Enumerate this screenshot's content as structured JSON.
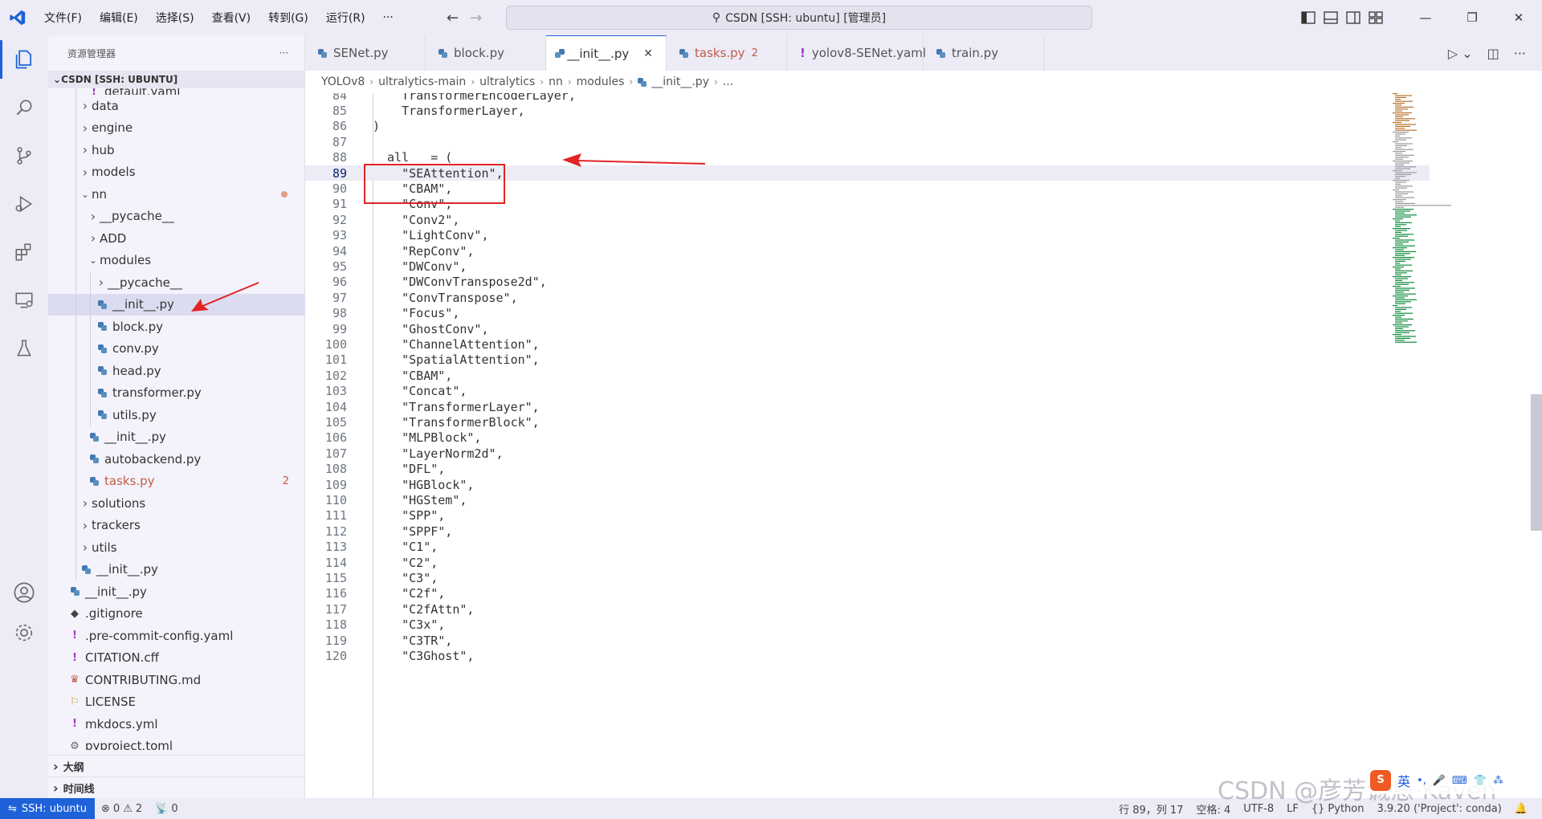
{
  "titlebar": {
    "menu": [
      "文件(F)",
      "编辑(E)",
      "选择(S)",
      "查看(V)",
      "转到(G)",
      "运行(R)",
      "···"
    ],
    "command_center": "CSDN [SSH: ubuntu] [管理员]",
    "accent": "#1e61d9"
  },
  "sidebar": {
    "title": "资源管理器",
    "more": "···",
    "section": "CSDN [SSH: UBUNTU]",
    "tree": [
      {
        "label": "default.yaml",
        "level": 2,
        "type": "yaml-partial"
      },
      {
        "label": "data",
        "level": 1,
        "type": "folder-closed"
      },
      {
        "label": "engine",
        "level": 1,
        "type": "folder-closed"
      },
      {
        "label": "hub",
        "level": 1,
        "type": "folder-closed"
      },
      {
        "label": "models",
        "level": 1,
        "type": "folder-closed"
      },
      {
        "label": "nn",
        "level": 1,
        "type": "folder-open",
        "status": "modified"
      },
      {
        "label": "__pycache__",
        "level": 2,
        "type": "folder-closed"
      },
      {
        "label": "ADD",
        "level": 2,
        "type": "folder-closed"
      },
      {
        "label": "modules",
        "level": 2,
        "type": "folder-open"
      },
      {
        "label": "__pycache__",
        "level": 3,
        "type": "folder-closed"
      },
      {
        "label": "__init__.py",
        "level": 3,
        "type": "py",
        "selected": true
      },
      {
        "label": "block.py",
        "level": 3,
        "type": "py"
      },
      {
        "label": "conv.py",
        "level": 3,
        "type": "py"
      },
      {
        "label": "head.py",
        "level": 3,
        "type": "py"
      },
      {
        "label": "transformer.py",
        "level": 3,
        "type": "py"
      },
      {
        "label": "utils.py",
        "level": 3,
        "type": "py"
      },
      {
        "label": "__init__.py",
        "level": 2,
        "type": "py"
      },
      {
        "label": "autobackend.py",
        "level": 2,
        "type": "py"
      },
      {
        "label": "tasks.py",
        "level": 2,
        "type": "py",
        "status": "error",
        "badge": "2"
      },
      {
        "label": "solutions",
        "level": 1,
        "type": "folder-closed"
      },
      {
        "label": "trackers",
        "level": 1,
        "type": "folder-closed"
      },
      {
        "label": "utils",
        "level": 1,
        "type": "folder-closed"
      },
      {
        "label": "__init__.py",
        "level": 1,
        "type": "py"
      },
      {
        "label": "__init__.py",
        "level": 0,
        "type": "py"
      },
      {
        "label": ".gitignore",
        "level": 0,
        "type": "git"
      },
      {
        "label": ".pre-commit-config.yaml",
        "level": 0,
        "type": "yaml"
      },
      {
        "label": "CITATION.cff",
        "level": 0,
        "type": "yaml"
      },
      {
        "label": "CONTRIBUTING.md",
        "level": 0,
        "type": "md"
      },
      {
        "label": "LICENSE",
        "level": 0,
        "type": "license"
      },
      {
        "label": "mkdocs.yml",
        "level": 0,
        "type": "yaml"
      },
      {
        "label": "pyproject.toml",
        "level": 0,
        "type": "toml-partial"
      }
    ],
    "bottom": [
      "大纲",
      "时间线"
    ]
  },
  "tabs": [
    {
      "label": "SENet.py",
      "type": "py"
    },
    {
      "label": "block.py",
      "type": "py"
    },
    {
      "label": "__init__.py",
      "type": "py",
      "active": true
    },
    {
      "label": "tasks.py",
      "type": "py",
      "error": true,
      "count": "2"
    },
    {
      "label": "yolov8-SENet.yaml",
      "type": "yaml"
    },
    {
      "label": "train.py",
      "type": "py"
    }
  ],
  "breadcrumb": [
    "YOLOv8",
    "ultralytics-main",
    "ultralytics",
    "nn",
    "modules",
    "__init__.py",
    "..."
  ],
  "editor": {
    "current_line": 89,
    "lines": [
      {
        "n": "84",
        "text": "    TransformerEncoderLayer,",
        "kind": "kw"
      },
      {
        "n": "85",
        "text": "    TransformerLayer,",
        "kind": "kw"
      },
      {
        "n": "86",
        "text": ")",
        "kind": "paren"
      },
      {
        "n": "87",
        "text": "",
        "kind": "plain"
      },
      {
        "n": "88",
        "text": "__all__ = (",
        "kind": "dunder"
      },
      {
        "n": "89",
        "text": "    \"SEAttention\",",
        "kind": "str"
      },
      {
        "n": "90",
        "text": "    \"CBAM\",",
        "kind": "str"
      },
      {
        "n": "91",
        "text": "    \"Conv\",",
        "kind": "str"
      },
      {
        "n": "92",
        "text": "    \"Conv2\",",
        "kind": "str"
      },
      {
        "n": "93",
        "text": "    \"LightConv\",",
        "kind": "str"
      },
      {
        "n": "94",
        "text": "    \"RepConv\",",
        "kind": "str"
      },
      {
        "n": "95",
        "text": "    \"DWConv\",",
        "kind": "str"
      },
      {
        "n": "96",
        "text": "    \"DWConvTranspose2d\",",
        "kind": "str"
      },
      {
        "n": "97",
        "text": "    \"ConvTranspose\",",
        "kind": "str"
      },
      {
        "n": "98",
        "text": "    \"Focus\",",
        "kind": "str"
      },
      {
        "n": "99",
        "text": "    \"GhostConv\",",
        "kind": "str"
      },
      {
        "n": "100",
        "text": "    \"ChannelAttention\",",
        "kind": "str"
      },
      {
        "n": "101",
        "text": "    \"SpatialAttention\",",
        "kind": "str"
      },
      {
        "n": "102",
        "text": "    \"CBAM\",",
        "kind": "str"
      },
      {
        "n": "103",
        "text": "    \"Concat\",",
        "kind": "str"
      },
      {
        "n": "104",
        "text": "    \"TransformerLayer\",",
        "kind": "str"
      },
      {
        "n": "105",
        "text": "    \"TransformerBlock\",",
        "kind": "str"
      },
      {
        "n": "106",
        "text": "    \"MLPBlock\",",
        "kind": "str"
      },
      {
        "n": "107",
        "text": "    \"LayerNorm2d\",",
        "kind": "str"
      },
      {
        "n": "108",
        "text": "    \"DFL\",",
        "kind": "str"
      },
      {
        "n": "109",
        "text": "    \"HGBlock\",",
        "kind": "str"
      },
      {
        "n": "110",
        "text": "    \"HGStem\",",
        "kind": "str"
      },
      {
        "n": "111",
        "text": "    \"SPP\",",
        "kind": "str"
      },
      {
        "n": "112",
        "text": "    \"SPPF\",",
        "kind": "str"
      },
      {
        "n": "113",
        "text": "    \"C1\",",
        "kind": "str"
      },
      {
        "n": "114",
        "text": "    \"C2\",",
        "kind": "str"
      },
      {
        "n": "115",
        "text": "    \"C3\",",
        "kind": "str"
      },
      {
        "n": "116",
        "text": "    \"C2f\",",
        "kind": "str"
      },
      {
        "n": "117",
        "text": "    \"C2fAttn\",",
        "kind": "str"
      },
      {
        "n": "118",
        "text": "    \"C3x\",",
        "kind": "str"
      },
      {
        "n": "119",
        "text": "    \"C3TR\",",
        "kind": "str"
      },
      {
        "n": "120",
        "text": "    \"C3Ghost\",",
        "kind": "str"
      }
    ]
  },
  "statusbar": {
    "remote": "SSH: ubuntu",
    "errors": "0",
    "warnings": "2",
    "ports": "0",
    "position": "行 89，列 17",
    "spaces": "空格: 4",
    "encoding": "UTF-8",
    "eol": "LF",
    "language": "Python",
    "interpreter": "3.9.20 ('Project': conda)"
  },
  "watermark": "CSDN @彦芳诚恳·Kaven",
  "ime_label": "英"
}
